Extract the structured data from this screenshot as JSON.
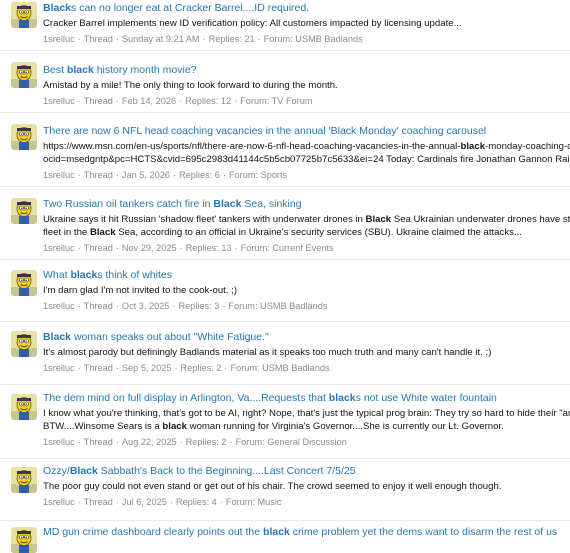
{
  "results": [
    {
      "title_parts": [
        {
          "t": "Black",
          "b": true
        },
        {
          "t": "s can no longer eat at Cracker Barrel....ID required.",
          "b": false
        }
      ],
      "snippet_lines": [
        [
          {
            "t": "Cracker Barrel implements new ID verification policy: All customers impacted by licensing update...",
            "b": false
          }
        ]
      ],
      "user": "1srelluc",
      "type": "Thread",
      "date": "Sunday at 9:21 AM",
      "replies": "Replies: 21",
      "forum": "Forum: USMB Badlands"
    },
    {
      "title_parts": [
        {
          "t": "Best ",
          "b": false
        },
        {
          "t": "black",
          "b": true
        },
        {
          "t": " history month movie?",
          "b": false
        }
      ],
      "snippet_lines": [
        [
          {
            "t": "Amistad by a mile! The only thing to look forward to during the month.",
            "b": false
          }
        ]
      ],
      "user": "1srelluc",
      "type": "Thread",
      "date": "Feb 14, 2026",
      "replies": "Replies: 12",
      "forum": "Forum: TV Forum"
    },
    {
      "title_parts": [
        {
          "t": "There are now 6 NFL head coaching vacancies in the annual 'Black Monday' coaching carousel",
          "b": false
        }
      ],
      "snippet_lines": [
        [
          {
            "t": "https://www.msn.com/en-us/sports/nfl/there-are-now-6-nfl-head-coaching-vacancies-in-the-annual-",
            "b": false
          },
          {
            "t": "black",
            "b": true
          },
          {
            "t": "-monday-coaching-carousel",
            "b": false
          }
        ],
        [
          {
            "t": "ocid=msedgntp&pc=HCTS&cvid=695c2983d41144c5b5cb07725b7c5633&ei=24 Today: Cardinals fire Jonathan Gannon Raiders fire",
            "b": false
          }
        ]
      ],
      "user": "1srelluc",
      "type": "Thread",
      "date": "Jan 5, 2026",
      "replies": "Replies: 6",
      "forum": "Forum: Sports"
    },
    {
      "title_parts": [
        {
          "t": "Two Russian oil tankers catch fire in ",
          "b": false
        },
        {
          "t": "Black",
          "b": true
        },
        {
          "t": " Sea, sinking",
          "b": false
        }
      ],
      "snippet_lines": [
        [
          {
            "t": "Ukraine says it hit Russian 'shadow fleet' tankers with underwater drones in ",
            "b": false
          },
          {
            "t": "Black",
            "b": true
          },
          {
            "t": " Sea Ukrainian underwater drones have struck two",
            "b": false
          }
        ],
        [
          {
            "t": "fleet in the ",
            "b": false
          },
          {
            "t": "Black",
            "b": true
          },
          {
            "t": " Sea, according to an official in Ukraine's security services (SBU). Ukraine claimed the attacks...",
            "b": false
          }
        ]
      ],
      "user": "1srelluc",
      "type": "Thread",
      "date": "Nov 29, 2025",
      "replies": "Replies: 13",
      "forum": "Forum: Current Events"
    },
    {
      "title_parts": [
        {
          "t": "What ",
          "b": false
        },
        {
          "t": "black",
          "b": true
        },
        {
          "t": "s think of whites",
          "b": false
        }
      ],
      "snippet_lines": [
        [
          {
            "t": "I'm darn glad I'm not invited to the cook-out. ;)",
            "b": false
          }
        ]
      ],
      "user": "1srelluc",
      "type": "Thread",
      "date": "Oct 3, 2025",
      "replies": "Replies: 3",
      "forum": "Forum: USMB Badlands"
    },
    {
      "title_parts": [
        {
          "t": "Black",
          "b": true
        },
        {
          "t": " woman speaks out about \"White Fatigue.\"",
          "b": false
        }
      ],
      "snippet_lines": [
        [
          {
            "t": "It's almost parody but definingly Badlands material as it speaks too much truth and many can't handle it. ;)",
            "b": false
          }
        ]
      ],
      "user": "1srelluc",
      "type": "Thread",
      "date": "Sep 5, 2025",
      "replies": "Replies: 2",
      "forum": "Forum: USMB Badlands"
    },
    {
      "title_parts": [
        {
          "t": "The dem mind on full display in Arlington, Va....Requests that ",
          "b": false
        },
        {
          "t": "black",
          "b": true
        },
        {
          "t": "s not use White water fountain",
          "b": false
        }
      ],
      "snippet_lines": [
        [
          {
            "t": "I know what you're thinking, that's got to be AI, right? Nope, that's just the typical prog brain: They try so hard to hide their \"anti-ethnic",
            "b": false
          }
        ],
        [
          {
            "t": "BTW....Winsome Sears is a ",
            "b": false
          },
          {
            "t": "black",
            "b": true
          },
          {
            "t": " woman running for Virginia's Governor....She is currently our Lt. Governor.",
            "b": false
          }
        ]
      ],
      "user": "1srelluc",
      "type": "Thread",
      "date": "Aug 22, 2025",
      "replies": "Replies: 2",
      "forum": "Forum: General Discussion"
    },
    {
      "title_parts": [
        {
          "t": "Ozzy/",
          "b": false
        },
        {
          "t": "Black",
          "b": true
        },
        {
          "t": " Sabbath's Back to the Beginning....Last Concert 7/5/25",
          "b": false
        }
      ],
      "snippet_lines": [
        [
          {
            "t": "The poor guy could not even stand or get out of his chair. The crowd seemed to enjoy it well enough though.",
            "b": false
          }
        ]
      ],
      "user": "1srelluc",
      "type": "Thread",
      "date": "Jul 6, 2025",
      "replies": "Replies: 4",
      "forum": "Forum: Music"
    },
    {
      "title_parts": [
        {
          "t": "MD gun crime dashboard clearly points out the ",
          "b": false
        },
        {
          "t": "black",
          "b": true
        },
        {
          "t": " crime problem yet the dems want to disarm the rest of us",
          "b": false
        }
      ],
      "snippet_lines": [],
      "user": "",
      "type": "",
      "date": "",
      "replies": "",
      "forum": ""
    }
  ]
}
